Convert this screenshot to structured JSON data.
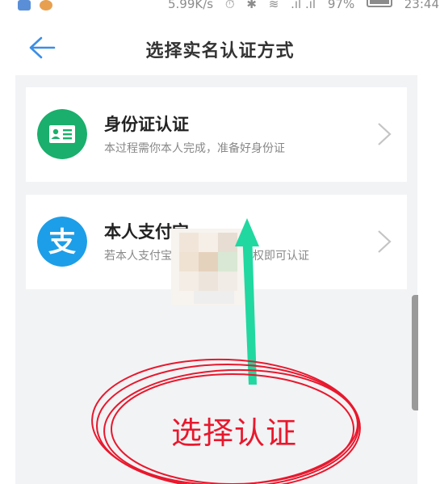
{
  "status_bar": {
    "network_speed": "5.99K/s",
    "battery_percent": "97%",
    "time": "23:44"
  },
  "header": {
    "title": "选择实名认证方式"
  },
  "options": [
    {
      "title": "身份证认证",
      "subtitle": "本过程需你本人完成，准备好身份证",
      "icon": "id-card-icon",
      "icon_color": "#1aaf6c"
    },
    {
      "title": "本人支付宝",
      "subtitle": "若本人支付宝",
      "subtitle_tail": "授权即可认证",
      "icon": "alipay-icon",
      "icon_color": "#1d9ee8"
    }
  ],
  "annotation": {
    "text": "选择认证",
    "color": "#e8182d",
    "arrow_color": "#20d8a0"
  }
}
